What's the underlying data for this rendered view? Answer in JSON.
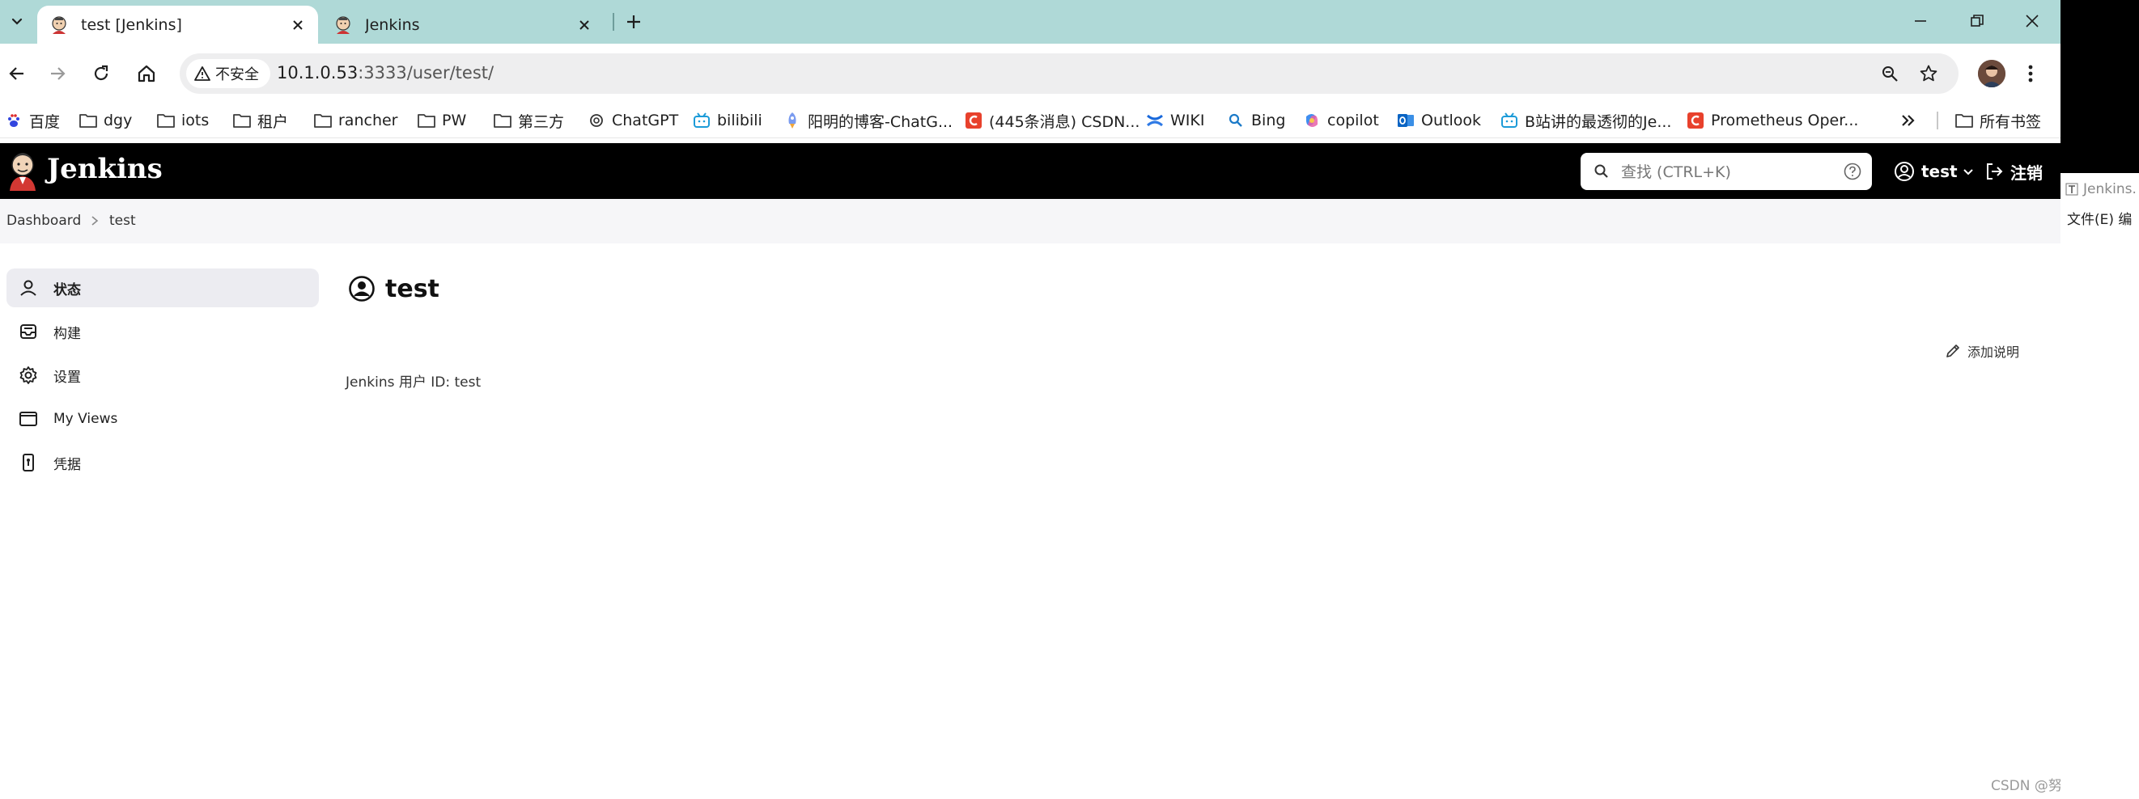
{
  "browser": {
    "tabs": [
      {
        "title": "test [Jenkins]",
        "active": true
      },
      {
        "title": "Jenkins",
        "active": false
      }
    ],
    "address": {
      "security_label": "不安全",
      "host": "10.1.0.53",
      "path": ":3333/user/test/"
    },
    "bookmarks": [
      {
        "label": "百度",
        "icon": "paw-icon"
      },
      {
        "label": "dgy",
        "icon": "folder-icon"
      },
      {
        "label": "iots",
        "icon": "folder-icon"
      },
      {
        "label": "租户",
        "icon": "folder-icon"
      },
      {
        "label": "rancher",
        "icon": "folder-icon"
      },
      {
        "label": "PW",
        "icon": "folder-icon"
      },
      {
        "label": "第三方",
        "icon": "folder-icon"
      },
      {
        "label": "ChatGPT",
        "icon": "openai-icon"
      },
      {
        "label": "bilibili",
        "icon": "bilibili-icon"
      },
      {
        "label": "阳明的博客-ChatG...",
        "icon": "rocket-icon"
      },
      {
        "label": "(445条消息) CSDN...",
        "icon": "csdn-icon"
      },
      {
        "label": "WIKI",
        "icon": "confluence-icon"
      },
      {
        "label": "Bing",
        "icon": "search-icon"
      },
      {
        "label": "copilot",
        "icon": "copilot-icon"
      },
      {
        "label": "Outlook",
        "icon": "outlook-icon"
      },
      {
        "label": "B站讲的最透彻的Je...",
        "icon": "bilibili-icon"
      },
      {
        "label": "Prometheus Oper...",
        "icon": "csdn-icon"
      }
    ],
    "all_bookmarks_label": "所有书签"
  },
  "jenkins": {
    "brand": "Jenkins",
    "search_placeholder": "查找 (CTRL+K)",
    "user_name": "test",
    "logout_label": "注销",
    "breadcrumb": [
      "Dashboard",
      "test"
    ],
    "sidebar": [
      {
        "label": "状态",
        "icon": "user-icon",
        "active": true
      },
      {
        "label": "构建",
        "icon": "inbox-icon",
        "active": false
      },
      {
        "label": "设置",
        "icon": "gear-icon",
        "active": false
      },
      {
        "label": "My Views",
        "icon": "window-icon",
        "active": false
      },
      {
        "label": "凭据",
        "icon": "credentials-icon",
        "active": false
      }
    ],
    "page_title": "test",
    "add_description_label": "添加说明",
    "user_id_text": "Jenkins 用户 ID: test"
  },
  "watermark": "CSDN @努力的Andy",
  "behind_window": {
    "title": "Jenkins.",
    "menu": "文件(E)  编"
  },
  "colors": {
    "tabstrip": "#afd9d7",
    "jenkins_header": "#000000",
    "breadcrumb_bg": "#f6f6f8",
    "active_side": "#ececf1"
  }
}
